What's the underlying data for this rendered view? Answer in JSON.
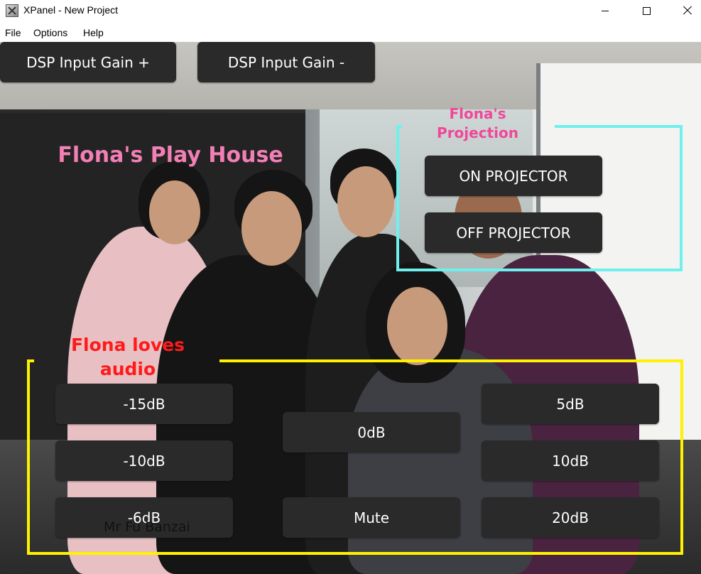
{
  "window": {
    "title": "XPanel - New Project",
    "icon": "xpanel-app-icon"
  },
  "menu": {
    "items": [
      "File",
      "Options",
      "Help"
    ]
  },
  "toolbar": {
    "gain_plus": "DSP Input Gain +",
    "gain_minus": "DSP Input Gain -"
  },
  "labels": {
    "house": "Flona's Play House",
    "projection": "Flona's Projection",
    "audio": "Flona loves audio",
    "person": "Mr Fu Banzai"
  },
  "projection": {
    "on": "ON PROJECTOR",
    "off": "OFF PROJECTOR"
  },
  "audio": {
    "m15": "-15dB",
    "m10": "-10dB",
    "m6": "-6dB",
    "zero": "0dB",
    "mute": "Mute",
    "p5": "5dB",
    "p10": "10dB",
    "p20": "20dB"
  },
  "colors": {
    "house_title": "#f27fb5",
    "projection_title": "#f0479a",
    "audio_title": "#ff1a1a",
    "projection_box": "#6ef0ee",
    "audio_box": "#fff200",
    "button_bg": "#2a2a2a"
  }
}
